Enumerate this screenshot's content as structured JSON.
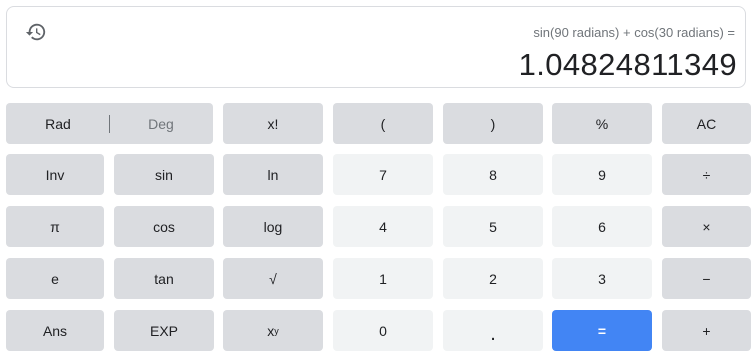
{
  "display": {
    "expression": "sin(90 radians) + cos(30 radians) =",
    "result": "1.04824811349",
    "history_icon": "history-icon"
  },
  "mode": {
    "rad_label": "Rad",
    "deg_label": "Deg",
    "active": "Rad"
  },
  "keys": {
    "factorial": "x!",
    "lparen": "(",
    "rparen": ")",
    "percent": "%",
    "clear": "AC",
    "inv": "Inv",
    "sin": "sin",
    "ln": "ln",
    "n7": "7",
    "n8": "8",
    "n9": "9",
    "divide": "÷",
    "pi": "π",
    "cos": "cos",
    "log": "log",
    "n4": "4",
    "n5": "5",
    "n6": "6",
    "multiply": "×",
    "e": "e",
    "tan": "tan",
    "sqrt": "√",
    "n1": "1",
    "n2": "2",
    "n3": "3",
    "minus": "−",
    "ans": "Ans",
    "exp": "EXP",
    "power_base": "x",
    "power_exp": "y",
    "n0": "0",
    "dot": ".",
    "equals": "=",
    "plus": "+"
  },
  "colors": {
    "function_key": "#dadce0",
    "number_key": "#f1f3f4",
    "equals_key": "#4285f4"
  }
}
